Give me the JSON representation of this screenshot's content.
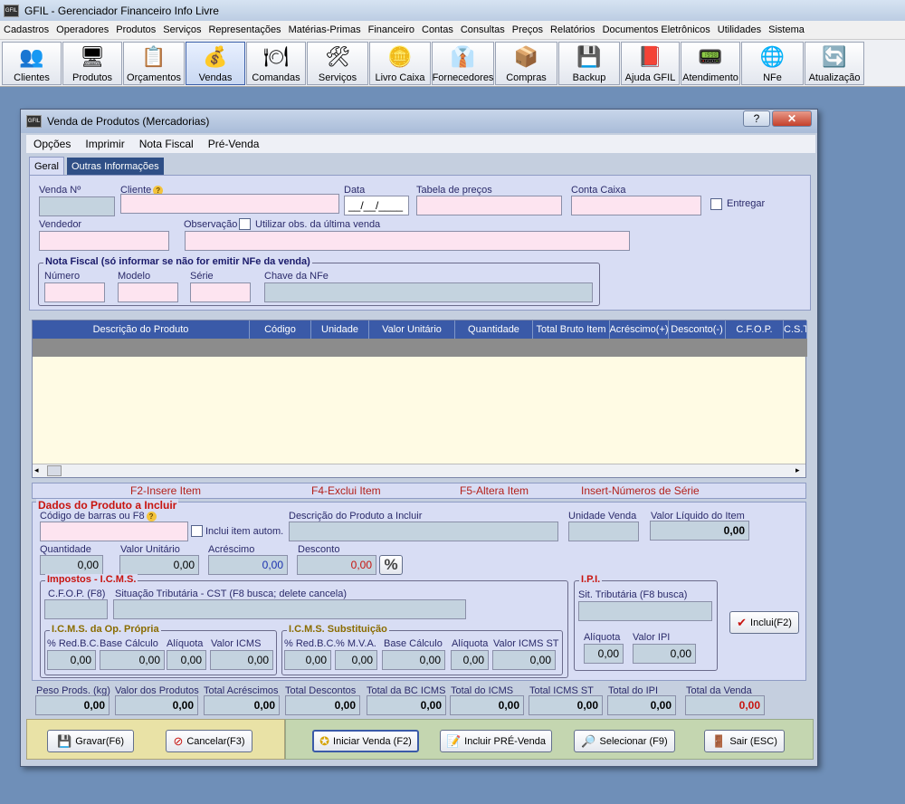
{
  "app": {
    "logo": "GFIL",
    "title": "GFIL - Gerenciador Financeiro Info Livre"
  },
  "menubar": [
    "Cadastros",
    "Operadores",
    "Produtos",
    "Serviços",
    "Representações",
    "Matérias-Primas",
    "Financeiro",
    "Contas",
    "Consultas",
    "Preços",
    "Relatórios",
    "Documentos Eletrônicos",
    "Utilidades",
    "Sistema"
  ],
  "toolbar": [
    {
      "label": "Clientes",
      "icon": "clients-icon",
      "glyph": "👥"
    },
    {
      "label": "Produtos",
      "icon": "monitor-icon",
      "glyph": "🖥"
    },
    {
      "label": "Orçamentos",
      "icon": "budget-icon",
      "glyph": "📋"
    },
    {
      "label": "Vendas",
      "icon": "cash-register-icon",
      "glyph": "💰"
    },
    {
      "label": "Comandas",
      "icon": "plate-icon",
      "glyph": "🍽"
    },
    {
      "label": "Serviços",
      "icon": "tools-icon",
      "glyph": "🛠"
    },
    {
      "label": "Livro Caixa",
      "icon": "coins-icon",
      "glyph": "🪙"
    },
    {
      "label": "Fornecedores",
      "icon": "supplier-icon",
      "glyph": "👔"
    },
    {
      "label": "Compras",
      "icon": "boxes-icon",
      "glyph": "📦"
    },
    {
      "label": "Backup",
      "icon": "floppy-icon",
      "glyph": "💾"
    },
    {
      "label": "Ajuda GFIL",
      "icon": "help-book-icon",
      "glyph": "📕"
    },
    {
      "label": "Atendimento",
      "icon": "support-icon",
      "glyph": "📟"
    },
    {
      "label": "NFe",
      "icon": "nfe-icon",
      "glyph": "🌐"
    },
    {
      "label": "Atualização",
      "icon": "update-icon",
      "glyph": "🔄"
    }
  ],
  "dialog": {
    "title": "Venda de Produtos (Mercadorias)",
    "help_btn": "?",
    "close_btn": "✕",
    "menu": [
      "Opções",
      "Imprimir",
      "Nota Fiscal",
      "Pré-Venda"
    ],
    "tabs": [
      "Geral",
      "Outras Informações"
    ],
    "header": {
      "venda_no": "Venda Nº",
      "cliente": "Cliente",
      "data": "Data",
      "data_value": "__/__/____",
      "tabela_precos": "Tabela de preços",
      "conta_caixa": "Conta Caixa",
      "entregar": "Entregar",
      "vendedor": "Vendedor",
      "observacao": "Observação",
      "utilizar_obs": "Utilizar obs. da última venda"
    },
    "nota_fiscal": {
      "title": "Nota Fiscal (só informar se não for emitir NFe da venda)",
      "numero": "Número",
      "modelo": "Modelo",
      "serie": "Série",
      "chave": "Chave da NFe"
    },
    "grid_columns": [
      "Descrição do Produto",
      "Código",
      "Unidade",
      "Valor Unitário",
      "Quantidade",
      "Total Bruto Item",
      "Acréscimo(+)",
      "Desconto(-)",
      "C.F.O.P.",
      "C.S.T"
    ],
    "hotkeys": [
      "F2-Insere Item",
      "F4-Exclui Item",
      "F5-Altera Item",
      "Insert-Números de Série"
    ],
    "produto": {
      "title": "Dados do Produto a Incluir",
      "codigo": "Código de barras ou F8",
      "inclui_auto": "Inclui item autom.",
      "descricao": "Descrição do Produto a Incluir",
      "unidade": "Unidade Venda",
      "valor_liquido": "Valor Líquido do Item",
      "valor_liquido_value": "0,00",
      "quantidade": "Quantidade",
      "quantidade_value": "0,00",
      "valor_unitario": "Valor Unitário",
      "valor_unitario_value": "0,00",
      "acrescimo": "Acréscimo",
      "acrescimo_value": "0,00",
      "desconto": "Desconto",
      "desconto_value": "0,00",
      "percent": "%"
    },
    "impostos": {
      "title": "Impostos - I.C.M.S.",
      "cfop": "C.F.O.P. (F8)",
      "situacao": "Situação Tributária - CST (F8 busca; delete cancela)",
      "propria_title": "I.C.M.S. da Op. Própria",
      "propria": [
        {
          "label": "% Red.B.C.",
          "value": "0,00"
        },
        {
          "label": "Base Cálculo",
          "value": "0,00"
        },
        {
          "label": "Alíquota",
          "value": "0,00"
        },
        {
          "label": "Valor ICMS",
          "value": "0,00"
        }
      ],
      "subst_title": "I.C.M.S. Substituição",
      "subst": [
        {
          "label": "% Red.B.C.",
          "value": "0,00"
        },
        {
          "label": "% M.V.A.",
          "value": "0,00"
        },
        {
          "label": "Base Cálculo",
          "value": "0,00"
        },
        {
          "label": "Alíquota",
          "value": "0,00"
        },
        {
          "label": "Valor ICMS ST",
          "value": "0,00"
        }
      ]
    },
    "ipi": {
      "title": "I.P.I.",
      "sit": "Sit. Tributária (F8 busca)",
      "aliquota": "Alíquota",
      "aliquota_value": "0,00",
      "valor": "Valor IPI",
      "valor_value": "0,00"
    },
    "inclui_btn": "Inclui(F2)",
    "totals": [
      {
        "label": "Peso Prods. (kg)",
        "value": "0,00"
      },
      {
        "label": "Valor dos Produtos",
        "value": "0,00"
      },
      {
        "label": "Total Acréscimos",
        "value": "0,00"
      },
      {
        "label": "Total Descontos",
        "value": "0,00"
      },
      {
        "label": "Total da BC ICMS",
        "value": "0,00"
      },
      {
        "label": "Total do ICMS",
        "value": "0,00"
      },
      {
        "label": "Total ICMS ST",
        "value": "0,00"
      },
      {
        "label": "Total do IPI",
        "value": "0,00"
      },
      {
        "label": "Total da Venda",
        "value": "0,00"
      }
    ],
    "buttons": {
      "gravar": "Gravar(F6)",
      "cancelar": "Cancelar(F3)",
      "iniciar": "Iniciar Venda (F2)",
      "pre_venda": "Incluir PRÉ-Venda",
      "selecionar": "Selecionar (F9)",
      "sair": "Sair (ESC)"
    }
  },
  "colors": {
    "accent_red": "#c8140f",
    "grid_header": "#3a5aa8",
    "panel_bg": "#d8ddf4",
    "input_pink": "#fde4f0"
  }
}
